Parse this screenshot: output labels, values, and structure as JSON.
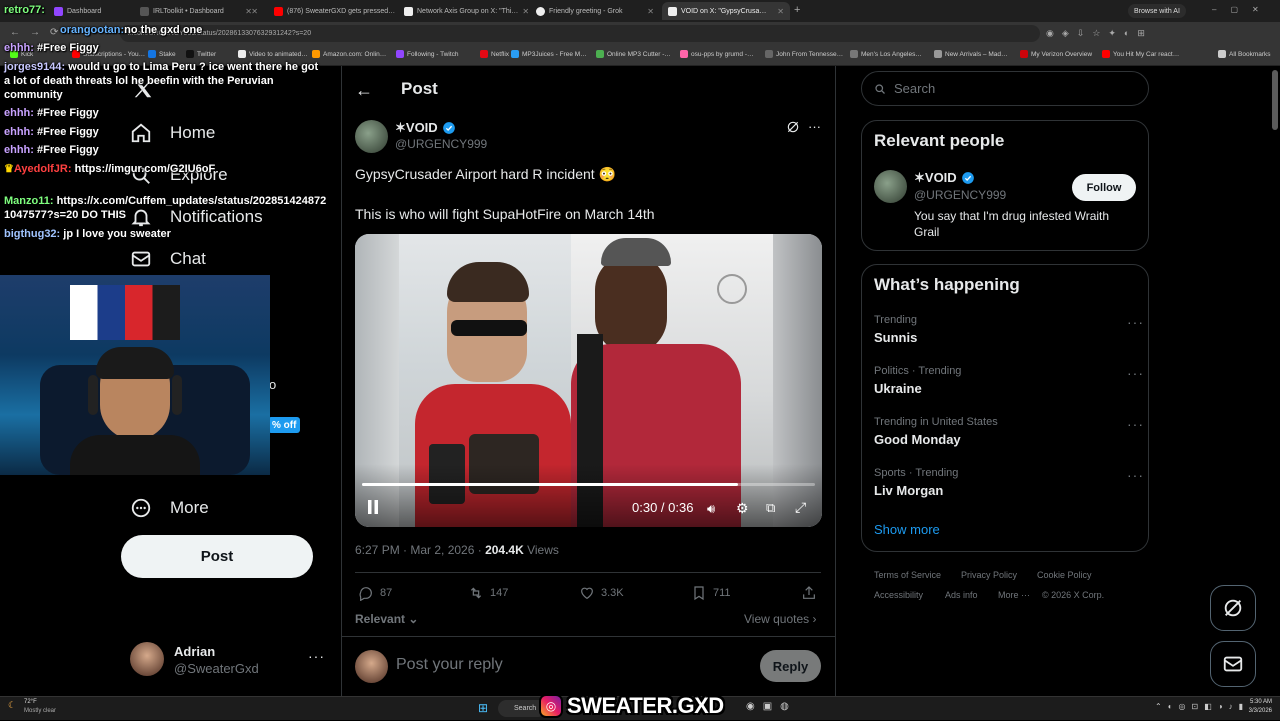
{
  "browser": {
    "tabs": [
      {
        "label": "Dashboard",
        "color": "#9146ff"
      },
      {
        "label": "IRLToolkit • Dashboard",
        "color": "#444"
      },
      {
        "label": "(876) SweaterGXD gets pressed…",
        "color": "#ff0000"
      },
      {
        "label": "Network Axis Group on X: \"Thi…",
        "color": "#111"
      },
      {
        "label": "Friendly greeting - Grok",
        "color": "#111"
      },
      {
        "label": "VOID on X: \"GypsyCrusa…",
        "color": "#111"
      }
    ],
    "browse_ai": "Browse with AI",
    "url": "x.com/URGENCY999/status/2028613307632931242?s=20",
    "bookmarks": [
      "Kick",
      "Subscriptions - You…",
      "Stake",
      "Twitter",
      "Video to animated…",
      "Amazon.com: Onlin…",
      "Following - Twitch",
      "Netflix",
      "MP3Juices - Free M…",
      "Online MP3 Cutter -…",
      "osu-pps by grumd -…",
      "John From Tennesse…",
      "Men's Los Angeles…",
      "New Arrivals – Mad…",
      "My Verizon Overview",
      "You Hit My Car react…",
      "All Bookmarks"
    ]
  },
  "nav": {
    "home": "Home",
    "explore": "Explore",
    "notifications": "Notifications",
    "chat": "Chat",
    "more": "More",
    "post": "Post",
    "discount": "% off",
    "partial_letter": "o"
  },
  "account": {
    "name": "Adrian",
    "handle": "@SweaterGxd"
  },
  "post": {
    "header": "Post",
    "author": "✶VOID",
    "handle": "@URGENCY999",
    "line1": "GypsyCrusader Airport hard R incident 😳",
    "line2": "This is who will fight SupaHotFire on March 14th",
    "video_time": "0:30 / 0:36",
    "video_progress": 0.83,
    "timestamp": "6:27 PM · Mar 2, 2026 · ",
    "views_count": "204.4K",
    "views_label": " Views",
    "replies": "87",
    "reposts": "147",
    "likes": "3.3K",
    "bookmarks": "711",
    "relevant": "Relevant",
    "view_quotes": "View quotes",
    "reply_placeholder": "Post your reply",
    "reply_button": "Reply"
  },
  "right": {
    "search_placeholder": "Search",
    "relevant_title": "Relevant people",
    "person_name": "✶VOID",
    "person_handle": "@URGENCY999",
    "follow": "Follow",
    "bio": "You say that I'm drug infested Wraith Grail",
    "happening_title": "What’s happening",
    "trends": [
      {
        "cat": "Trending",
        "name": "Sunnis"
      },
      {
        "cat": "Politics · Trending",
        "name": "Ukraine"
      },
      {
        "cat": "Trending in United States",
        "name": "Good Monday"
      },
      {
        "cat": "Sports · Trending",
        "name": "Liv Morgan"
      }
    ],
    "show_more": "Show more",
    "footer": [
      "Terms of Service",
      "Privacy Policy",
      "Cookie Policy",
      "Accessibility",
      "Ads info",
      "More ···",
      "© 2026 X Corp."
    ]
  },
  "chat": [
    {
      "user": "retro77:",
      "color": "#7fff7f",
      "msg": ""
    },
    {
      "user": "orangootan:",
      "color": "#66b3ff",
      "msg": "no the gxd one"
    },
    {
      "user": "ehhh:",
      "color": "#c8a2ff",
      "msg": "#Free Figgy"
    },
    {
      "user": "jorges9144:",
      "color": "#c8c8ff",
      "msg": "would u go to Lima Peru ? ice went there he got a lot of death threats lol he beefin with the Peruvian community"
    },
    {
      "user": "ehhh:",
      "color": "#c8a2ff",
      "msg": "#Free Figgy"
    },
    {
      "user": "ehhh:",
      "color": "#c8a2ff",
      "msg": "#Free Figgy"
    },
    {
      "user": "ehhh:",
      "color": "#c8a2ff",
      "msg": "#Free Figgy"
    },
    {
      "user": "AyedolfJR:",
      "color": "#ff4040",
      "msg": "https://imgur.com/G2IU6oF"
    },
    {
      "user": "Manzo11:",
      "color": "#7fff7f",
      "msg": "https://x.com/Cuffem_updates/status/2028514248721047577?s=20 DO THIS"
    },
    {
      "user": "bigthug32:",
      "color": "#a0c4ff",
      "msg": "jp I love you sweater"
    }
  ],
  "taskbar": {
    "temp": "72°F",
    "weather": "Mostly clear",
    "search": "Search",
    "watermark": "SWEATER.GXD",
    "time": "5:30 AM",
    "date": "3/3/2026"
  }
}
